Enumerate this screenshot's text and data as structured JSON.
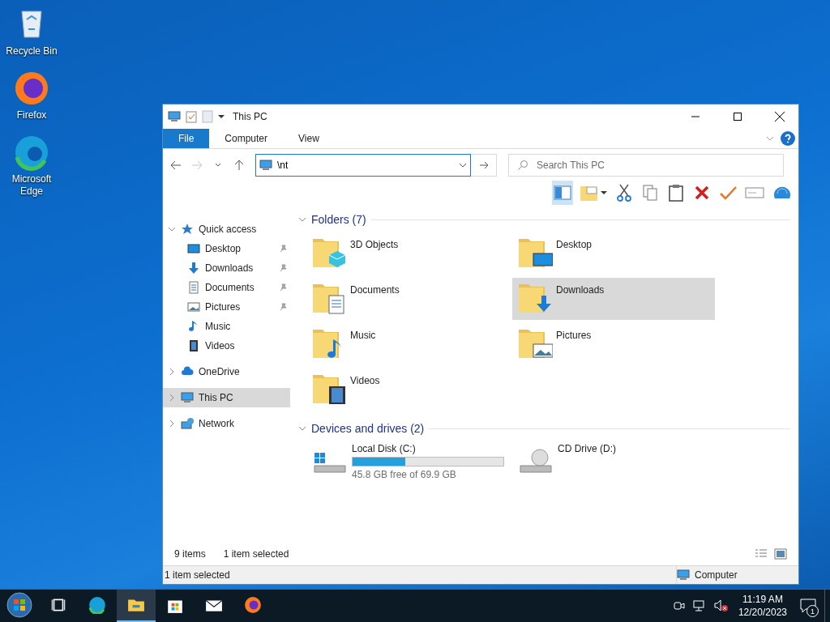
{
  "desktop_icons": [
    {
      "kind": "recycle",
      "label": "Recycle Bin"
    },
    {
      "kind": "firefox",
      "label": "Firefox"
    },
    {
      "kind": "edge",
      "label": "Microsoft Edge"
    }
  ],
  "window": {
    "title": "This PC",
    "ribbon_tabs": [
      {
        "label": "File",
        "selected": true
      },
      {
        "label": "Computer",
        "selected": false
      },
      {
        "label": "View",
        "selected": false
      }
    ],
    "address": {
      "value": "\\nt"
    },
    "search": {
      "placeholder": "Search This PC"
    },
    "nav": [
      {
        "kind": "star",
        "label": "Quick access",
        "expanded": true,
        "selected": false,
        "children": [
          {
            "kind": "desktop",
            "label": "Desktop",
            "pinned": true,
            "selected": false
          },
          {
            "kind": "downloads",
            "label": "Downloads",
            "pinned": true,
            "selected": false
          },
          {
            "kind": "documents",
            "label": "Documents",
            "pinned": true,
            "selected": false
          },
          {
            "kind": "pictures",
            "label": "Pictures",
            "pinned": true,
            "selected": false
          },
          {
            "kind": "music",
            "label": "Music",
            "pinned": false,
            "selected": false
          },
          {
            "kind": "videos",
            "label": "Videos",
            "pinned": false,
            "selected": false
          }
        ]
      },
      {
        "kind": "cloud",
        "label": "OneDrive",
        "expanded": false,
        "selected": false
      },
      {
        "kind": "pc",
        "label": "This PC",
        "expanded": false,
        "selected": true
      },
      {
        "kind": "network",
        "label": "Network",
        "expanded": false,
        "selected": false
      }
    ],
    "folders": {
      "title": "Folders (7)",
      "items": [
        {
          "kind": "objects",
          "label": "3D Objects",
          "selected": false
        },
        {
          "kind": "desktop",
          "label": "Desktop",
          "selected": false
        },
        {
          "kind": "documents",
          "label": "Documents",
          "selected": false
        },
        {
          "kind": "downloads",
          "label": "Downloads",
          "selected": true
        },
        {
          "kind": "music",
          "label": "Music",
          "selected": false
        },
        {
          "kind": "pictures",
          "label": "Pictures",
          "selected": false
        },
        {
          "kind": "videos",
          "label": "Videos",
          "selected": false
        }
      ]
    },
    "drives": {
      "title": "Devices and drives (2)",
      "items": [
        {
          "kind": "disk",
          "label": "Local Disk (C:)",
          "level": 0.35,
          "free": "45.8 GB free of 69.9 GB"
        },
        {
          "kind": "cd",
          "label": "CD Drive (D:)"
        }
      ]
    },
    "item_count": "9 items",
    "selection_count": "1 item selected",
    "status_bar": {
      "left": "1 item selected",
      "right": "Computer"
    }
  },
  "taskbar": {
    "apps": [
      {
        "kind": "taskview",
        "selected": false
      },
      {
        "kind": "edge",
        "selected": false
      },
      {
        "kind": "explorer",
        "selected": true
      },
      {
        "kind": "store",
        "selected": false
      },
      {
        "kind": "mail",
        "selected": false
      },
      {
        "kind": "firefox",
        "selected": false
      }
    ],
    "time": "11:19 AM",
    "date": "12/20/2023",
    "notifications": "1"
  }
}
